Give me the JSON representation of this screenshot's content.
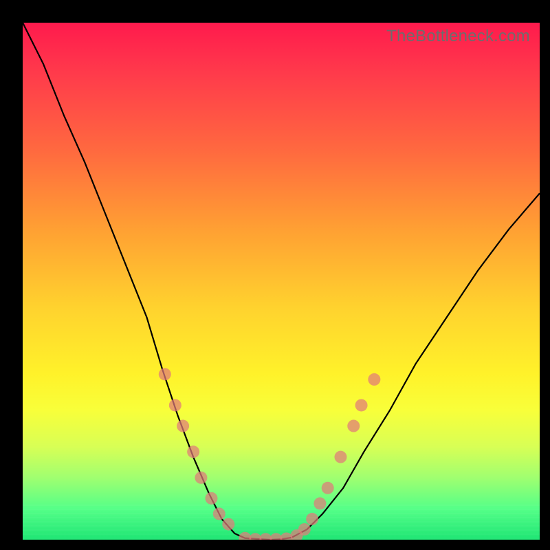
{
  "attribution": "TheBottleneck.com",
  "chart_data": {
    "type": "line",
    "title": "",
    "xlabel": "",
    "ylabel": "",
    "xlim": [
      0,
      100
    ],
    "ylim": [
      0,
      100
    ],
    "grid": false,
    "legend": false,
    "background_gradient": {
      "top_color": "#ff1a4d",
      "bottom_color": "#1fe574",
      "description": "red (high bottleneck) at top → green (no bottleneck) at bottom"
    },
    "series": [
      {
        "name": "left-branch",
        "description": "steep descending curve from top-left toward valley floor",
        "x": [
          0,
          4,
          8,
          12,
          16,
          20,
          24,
          27,
          30,
          33,
          36,
          38.5,
          41,
          43
        ],
        "y": [
          100,
          92,
          82,
          73,
          63,
          53,
          43,
          33,
          24,
          16,
          9,
          4,
          1.2,
          0.3
        ]
      },
      {
        "name": "valley-floor",
        "x": [
          43,
          46,
          48,
          50,
          52
        ],
        "y": [
          0.3,
          0.1,
          0.0,
          0.1,
          0.4
        ]
      },
      {
        "name": "right-branch",
        "description": "ascending curve from valley toward upper-right, shallower than left",
        "x": [
          52,
          55,
          58,
          62,
          66,
          71,
          76,
          82,
          88,
          94,
          100
        ],
        "y": [
          0.4,
          2,
          5,
          10,
          17,
          25,
          34,
          43,
          52,
          60,
          67
        ]
      }
    ],
    "markers": {
      "description": "salmon-colored dots clustered on the lower walls of the V and along the valley floor",
      "color": "#e07a7a",
      "radius": 9,
      "points": [
        {
          "x": 27.5,
          "y": 32
        },
        {
          "x": 29.5,
          "y": 26
        },
        {
          "x": 31,
          "y": 22
        },
        {
          "x": 33,
          "y": 17
        },
        {
          "x": 34.5,
          "y": 12
        },
        {
          "x": 36.5,
          "y": 8
        },
        {
          "x": 38,
          "y": 5
        },
        {
          "x": 39.8,
          "y": 3
        },
        {
          "x": 43,
          "y": 0.3
        },
        {
          "x": 45,
          "y": 0.1
        },
        {
          "x": 47,
          "y": 0.1
        },
        {
          "x": 49,
          "y": 0.1
        },
        {
          "x": 51,
          "y": 0.2
        },
        {
          "x": 53,
          "y": 0.8
        },
        {
          "x": 54.5,
          "y": 2
        },
        {
          "x": 56,
          "y": 4
        },
        {
          "x": 57.5,
          "y": 7
        },
        {
          "x": 59,
          "y": 10
        },
        {
          "x": 61.5,
          "y": 16
        },
        {
          "x": 64,
          "y": 22
        },
        {
          "x": 65.5,
          "y": 26
        },
        {
          "x": 68,
          "y": 31
        }
      ]
    }
  }
}
